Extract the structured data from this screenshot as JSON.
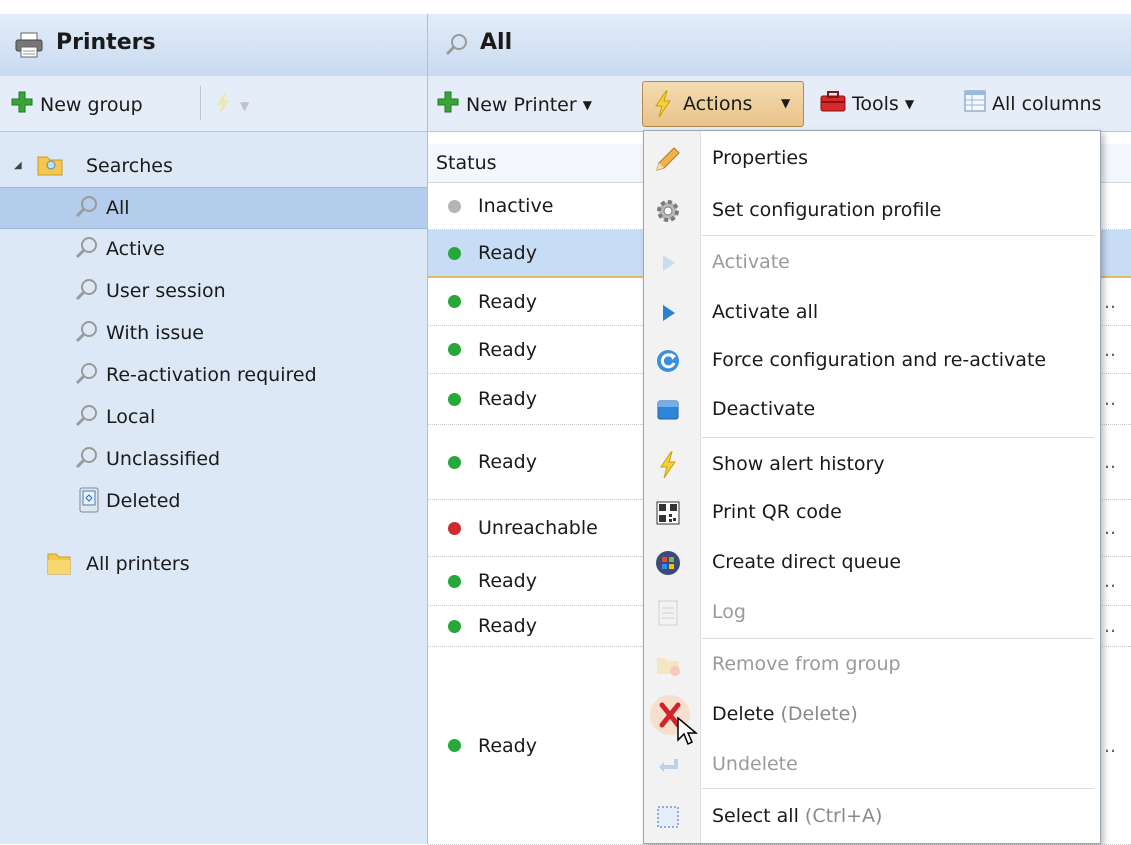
{
  "left_panel": {
    "title": "Printers",
    "new_group_label": "New group",
    "tree": {
      "root_label": "Searches",
      "items": [
        "All",
        "Active",
        "User session",
        "With issue",
        "Re-activation required",
        "Local",
        "Unclassified",
        "Deleted"
      ],
      "selected": "All",
      "all_printers_label": "All printers"
    }
  },
  "right_panel": {
    "title": "All",
    "toolbar": {
      "new_printer_label": "New Printer",
      "actions_label": "Actions",
      "tools_label": "Tools",
      "columns_label": "All columns"
    },
    "table": {
      "column_header": "Status",
      "rows": [
        {
          "status": "Inactive",
          "color": "#b4b4b4"
        },
        {
          "status": "Ready",
          "color": "#27a83a"
        },
        {
          "status": "Ready",
          "color": "#27a83a"
        },
        {
          "status": "Ready",
          "color": "#27a83a"
        },
        {
          "status": "Ready",
          "color": "#27a83a"
        },
        {
          "status": "Ready",
          "color": "#27a83a"
        },
        {
          "status": "Unreachable",
          "color": "#d12a2a"
        },
        {
          "status": "Ready",
          "color": "#27a83a"
        },
        {
          "status": "Ready",
          "color": "#27a83a"
        },
        {
          "status": "Ready",
          "color": "#27a83a"
        }
      ],
      "selected_row_index": 1
    }
  },
  "actions_menu": {
    "items": [
      {
        "label": "Properties",
        "enabled": true,
        "icon": "pencil-icon"
      },
      {
        "label": "Set configuration profile",
        "enabled": true,
        "icon": "gear-icon"
      },
      {
        "label": "Activate",
        "enabled": false,
        "icon": "play-icon"
      },
      {
        "label": "Activate all",
        "enabled": true,
        "icon": "play-icon"
      },
      {
        "label": "Force configuration and re-activate",
        "enabled": true,
        "icon": "refresh-icon"
      },
      {
        "label": "Deactivate",
        "enabled": true,
        "icon": "stop-icon"
      },
      {
        "label": "Show alert history",
        "enabled": true,
        "icon": "lightning-icon"
      },
      {
        "label": "Print QR code",
        "enabled": true,
        "icon": "qr-code-icon"
      },
      {
        "label": "Create direct queue",
        "enabled": true,
        "icon": "windows-icon"
      },
      {
        "label": "Log",
        "enabled": false,
        "icon": "log-icon"
      },
      {
        "label": "Remove from group",
        "enabled": false,
        "icon": "remove-folder-icon"
      },
      {
        "label": "Delete",
        "shortcut": "(Delete)",
        "enabled": true,
        "icon": "delete-icon"
      },
      {
        "label": "Undelete",
        "enabled": false,
        "icon": "undo-icon"
      },
      {
        "label": "Select all",
        "shortcut": "(Ctrl+A)",
        "enabled": true,
        "icon": "select-all-icon"
      }
    ]
  },
  "colors": {
    "accent": "#c9daf0",
    "actions_button": "#ecc88f",
    "ready": "#27a83a",
    "unreachable": "#d12a2a",
    "inactive": "#b4b4b4"
  }
}
